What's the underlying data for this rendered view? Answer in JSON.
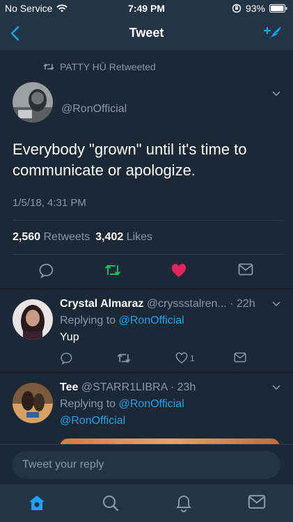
{
  "status_bar": {
    "carrier": "No Service",
    "time": "7:49 PM",
    "battery": "93%"
  },
  "nav": {
    "title": "Tweet"
  },
  "tweet": {
    "retweeted_by": "PATTY HŪ Retweeted",
    "handle": "@RonOfficial",
    "text": "Everybody \"grown\" until it's time to communicate or apologize.",
    "timestamp": "1/5/18, 4:31 PM",
    "retweets_count": "2,560",
    "retweets_label": "Retweets",
    "likes_count": "3,402",
    "likes_label": "Likes"
  },
  "replies": [
    {
      "name": "Crystal Almaraz",
      "handle_time": "@cryssstalren... · 22h",
      "replying_prefix": "Replying to",
      "replying_to": "@RonOfficial",
      "text": "Yup",
      "like_count": "1"
    },
    {
      "name": "Tee",
      "handle_time": "@STARR1LIBRA · 23h",
      "replying_prefix": "Replying to",
      "replying_to": "@RonOfficial",
      "text": "@RonOfficial"
    }
  ],
  "composer": {
    "placeholder": "Tweet your reply"
  },
  "tab_bar": {
    "items": [
      "home-icon",
      "search-icon",
      "notifications-icon",
      "messages-icon"
    ]
  },
  "colors": {
    "background": "#141d26",
    "card": "#1b2836",
    "bar": "#243447",
    "accent": "#1da1f2",
    "retweet": "#17bf63",
    "like": "#e0245e",
    "muted": "#8899a6"
  }
}
